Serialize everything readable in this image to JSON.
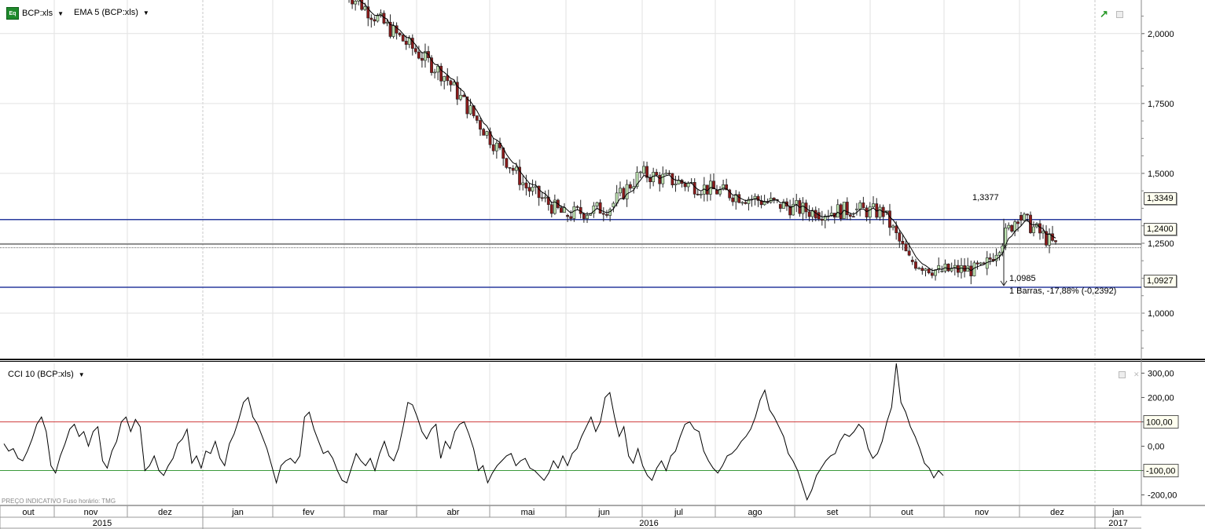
{
  "header": {
    "symbol": "BCP:xls",
    "overlay": "EMA 5 (BCP:xls)",
    "lower_indicator": "CCI 10 (BCP:xls)"
  },
  "price_tags": {
    "top_line": "1,3349",
    "current": "1,2400",
    "bottom_line": "1,0927"
  },
  "measure": {
    "start_value": "1,3377",
    "end_value": "1,0985",
    "summary": "1 Barras, -17,88% (-0,2392)"
  },
  "footer": {
    "note": "PREÇO INDICATIVO   Fuso horário: TMG"
  },
  "colors": {
    "up": "#bde3b0",
    "down": "#8b1a1a",
    "ema": "#000000",
    "hline": "#2a3c9e",
    "cci_upper": "#d04040",
    "cci_lower": "#3a9a3a"
  },
  "chart_data": [
    {
      "type": "candlestick",
      "title": "",
      "overlay": "EMA 5",
      "ylim": [
        0.84,
        2.12
      ],
      "y_ticks": [
        "2,0000",
        "1,7500",
        "1,5000",
        "1,2500",
        "1,0000"
      ],
      "y_tick_values": [
        2.0,
        1.75,
        1.5,
        1.25,
        1.0
      ],
      "horizontal_lines": [
        1.3349,
        1.24,
        1.0927
      ],
      "x_months": [
        "out",
        "nov",
        "dez",
        "jan",
        "fev",
        "mar",
        "abr",
        "mai",
        "jun",
        "jul",
        "ago",
        "set",
        "out",
        "nov",
        "dez",
        "jan"
      ],
      "x_years": [
        "2015",
        "2016",
        "2017"
      ],
      "segments": [
        {
          "x0": -3.0,
          "x1": -1.6,
          "open": 2.16,
          "close": 1.85,
          "low": 1.6,
          "high": 2.2
        },
        {
          "x0": -1.6,
          "x1": -0.5,
          "open": 1.85,
          "close": 1.45,
          "low": 1.35,
          "high": 1.9
        },
        {
          "x0": -0.5,
          "x1": 0.0,
          "open": 1.45,
          "close": 1.35,
          "low": 1.3,
          "high": 1.55
        },
        {
          "x0": 0.0,
          "x1": 0.6,
          "open": 1.35,
          "close": 1.38,
          "low": 1.3,
          "high": 1.45
        },
        {
          "x0": 0.6,
          "x1": 1.0,
          "open": 1.38,
          "close": 1.5,
          "low": 1.33,
          "high": 1.58
        },
        {
          "x0": 1.0,
          "x1": 2.0,
          "open": 1.5,
          "close": 1.44,
          "low": 1.35,
          "high": 1.6
        },
        {
          "x0": 2.0,
          "x1": 2.8,
          "open": 1.44,
          "close": 1.39,
          "low": 1.32,
          "high": 1.46
        },
        {
          "x0": 2.8,
          "x1": 3.3,
          "open": 1.39,
          "close": 1.36,
          "low": 1.34,
          "high": 1.44
        },
        {
          "x0": 3.3,
          "x1": 3.8,
          "open": 1.36,
          "close": 1.37,
          "low": 1.33,
          "high": 1.4
        },
        {
          "x0": 3.8,
          "x1": 4.2,
          "open": 1.37,
          "close": 1.36,
          "low": 1.3,
          "high": 1.42
        },
        {
          "x0": 4.2,
          "x1": 4.55,
          "open": 1.36,
          "close": 1.19,
          "low": 1.1,
          "high": 1.37
        },
        {
          "x0": 4.55,
          "x1": 4.95,
          "open": 1.19,
          "close": 1.15,
          "low": 1.08,
          "high": 1.2
        },
        {
          "x0": 4.95,
          "x1": 5.55,
          "open": 1.15,
          "close": 1.16,
          "low": 1.12,
          "high": 1.18
        },
        {
          "x0": 5.55,
          "x1": 6.0,
          "open": 1.16,
          "close": 1.35,
          "low": 1.15,
          "high": 1.38
        },
        {
          "x0": 6.0,
          "x1": 6.5,
          "open": 1.35,
          "close": 1.24,
          "low": 1.21,
          "high": 1.36
        }
      ]
    },
    {
      "type": "line",
      "title": "CCI 10",
      "ylim": [
        -240,
        340
      ],
      "y_ticks": [
        "300,00",
        "200,00",
        "100,00",
        "0,00",
        "-100,00",
        "-200,00"
      ],
      "y_tick_values": [
        300,
        200,
        100,
        0,
        -100,
        -200
      ],
      "reference_lines": [
        100,
        -100
      ],
      "values": [
        10,
        -20,
        -10,
        -50,
        -60,
        -20,
        30,
        90,
        120,
        60,
        -80,
        -110,
        -40,
        10,
        70,
        90,
        40,
        60,
        0,
        60,
        80,
        -60,
        -90,
        -20,
        20,
        100,
        120,
        60,
        110,
        80,
        -100,
        -80,
        -40,
        -100,
        -120,
        -80,
        -50,
        10,
        30,
        70,
        -70,
        -40,
        -90,
        -20,
        -30,
        20,
        -50,
        -80,
        10,
        50,
        110,
        180,
        200,
        120,
        90,
        40,
        -10,
        -80,
        -150,
        -80,
        -60,
        -50,
        -70,
        -40,
        120,
        140,
        70,
        20,
        -30,
        -20,
        -50,
        -100,
        -140,
        -150,
        -90,
        -30,
        -60,
        -80,
        -50,
        -100,
        -30,
        20,
        -40,
        -60,
        -10,
        80,
        180,
        170,
        120,
        60,
        30,
        70,
        90,
        -50,
        20,
        -10,
        60,
        90,
        100,
        50,
        -10,
        -100,
        -80,
        -150,
        -110,
        -80,
        -60,
        -40,
        -30,
        -80,
        -60,
        -50,
        -90,
        -100,
        -120,
        -140,
        -110,
        -60,
        -90,
        -40,
        -80,
        -30,
        -10,
        40,
        80,
        120,
        60,
        100,
        200,
        220,
        120,
        40,
        80,
        -40,
        -70,
        -10,
        -80,
        -120,
        -140,
        -90,
        -60,
        -100,
        -40,
        -20,
        40,
        90,
        100,
        70,
        60,
        -20,
        -60,
        -90,
        -110,
        -80,
        -40,
        -30,
        -10,
        20,
        40,
        70,
        120,
        190,
        230,
        150,
        120,
        80,
        40,
        -30,
        -60,
        -100,
        -160,
        -220,
        -180,
        -120,
        -90,
        -60,
        -40,
        -30,
        20,
        50,
        40,
        60,
        90,
        70,
        -10,
        -50,
        -30,
        20,
        100,
        160,
        340,
        180,
        140,
        80,
        40,
        -10,
        -70,
        -90,
        -130,
        -100,
        -120
      ]
    }
  ]
}
